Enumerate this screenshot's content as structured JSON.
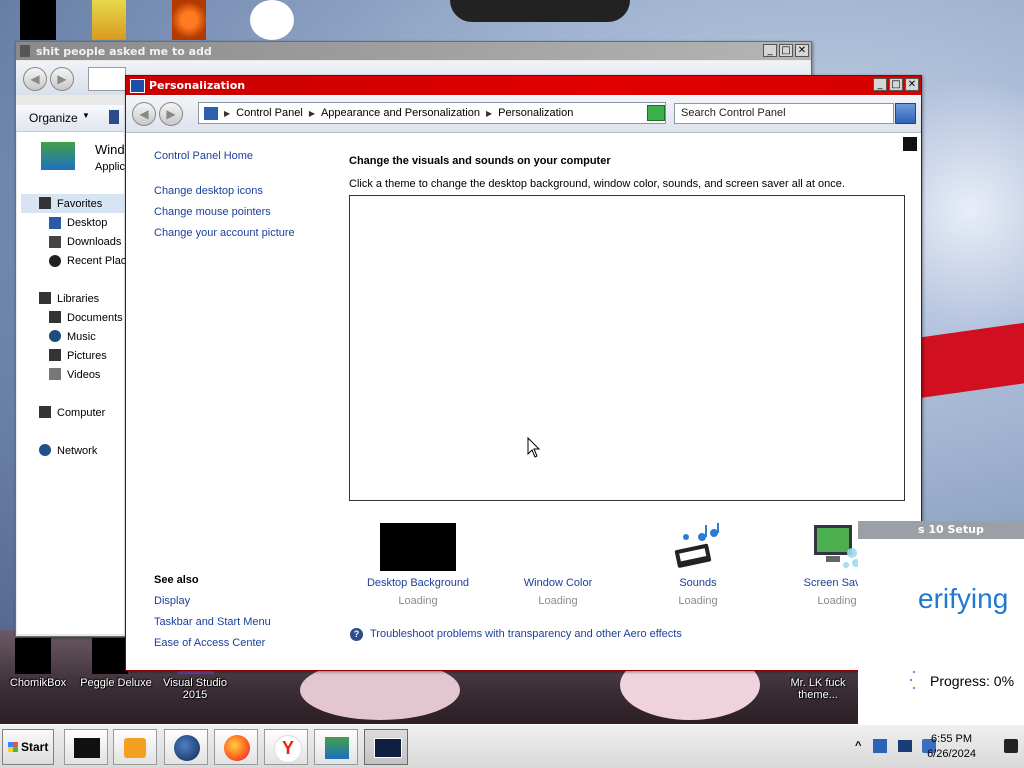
{
  "explorer": {
    "title": "shit people asked me to add",
    "organize_label": "Organize",
    "header_title": "Wind",
    "header_sub": "Applic",
    "nav": {
      "favorites": "Favorites",
      "desktop": "Desktop",
      "downloads": "Downloads",
      "recent": "Recent Plac",
      "libraries": "Libraries",
      "documents": "Documents",
      "music": "Music",
      "pictures": "Pictures",
      "videos": "Videos",
      "computer": "Computer",
      "network": "Network"
    }
  },
  "personalization": {
    "title": "Personalization",
    "breadcrumb": [
      "Control Panel",
      "Appearance and Personalization",
      "Personalization"
    ],
    "search_placeholder": "Search Control Panel",
    "sidebar_links": {
      "home": "Control Panel Home",
      "desktop_icons": "Change desktop icons",
      "mouse_pointers": "Change mouse pointers",
      "account_picture": "Change your account picture"
    },
    "see_also": {
      "heading": "See also",
      "display": "Display",
      "taskbar": "Taskbar and Start Menu",
      "ease": "Ease of Access Center"
    },
    "main_heading": "Change the visuals and sounds on your computer",
    "main_desc": "Click a theme to change the desktop background, window color, sounds, and screen saver all at once.",
    "options": [
      {
        "label": "Desktop Background",
        "status": "Loading"
      },
      {
        "label": "Window Color",
        "status": "Loading"
      },
      {
        "label": "Sounds",
        "status": "Loading"
      },
      {
        "label": "Screen Saver",
        "status": "Loading"
      }
    ],
    "troubleshoot": "Troubleshoot problems with transparency and other Aero effects"
  },
  "setup_window": {
    "title": "s 10 Setup",
    "status": "erifying",
    "progress_label": "Progress: 0%",
    "progress_value": 0
  },
  "desktop_icons": [
    {
      "label": "ChomikBox"
    },
    {
      "label": "Peggle Deluxe"
    },
    {
      "label": "Visual Studio 2015"
    },
    {
      "label": "Mr. LK fuck theme..."
    }
  ],
  "taskbar": {
    "start_label": "Start",
    "time": "6:55 PM",
    "date": "6/26/2024",
    "tray_chevron": "^"
  },
  "colors": {
    "title_red": "#e00000",
    "link_blue": "#1c3f9c",
    "setup_blue": "#1e78d4"
  }
}
